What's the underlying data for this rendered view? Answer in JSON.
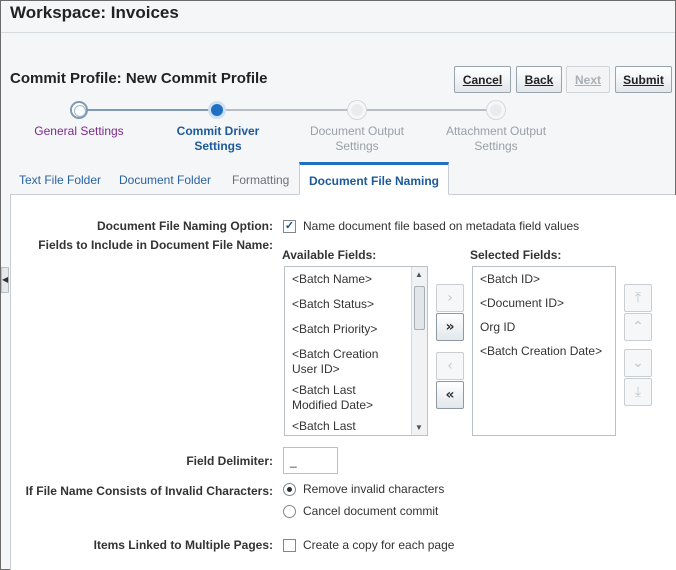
{
  "workspace_title": "Workspace: Invoices",
  "profile_title": "Commit Profile: New Commit Profile",
  "buttons": {
    "cancel": "Cancel",
    "back": "Back",
    "next": "Next",
    "submit": "Submit"
  },
  "train": {
    "steps": [
      {
        "line1": "General Settings",
        "line2": "",
        "state": "visited"
      },
      {
        "line1": "Commit Driver",
        "line2": "Settings",
        "state": "current"
      },
      {
        "line1": "Document Output",
        "line2": "Settings",
        "state": "unvisited"
      },
      {
        "line1": "Attachment Output",
        "line2": "Settings",
        "state": "unvisited"
      }
    ]
  },
  "tabs": [
    "Text File Folder",
    "Document Folder",
    "Formatting",
    "Document File Naming"
  ],
  "form": {
    "naming_option_label": "Document File Naming Option:",
    "naming_option_checked": true,
    "naming_option_text": "Name document file based on metadata field values",
    "fields_label": "Fields to Include in Document File Name:",
    "available_header": "Available Fields:",
    "selected_header": "Selected Fields:",
    "available_fields": [
      "<Batch Name>",
      "<Batch Status>",
      "<Batch Priority>",
      "<Batch Creation User ID>",
      "<Batch Last Modified Date>",
      "<Batch Last Modified User>"
    ],
    "selected_fields": [
      "<Batch ID>",
      "<Document ID>",
      "Org ID",
      "<Batch Creation Date>"
    ],
    "delimiter_label": "Field Delimiter:",
    "delimiter_value": "_",
    "invalid_label": "If File Name Consists of Invalid Characters:",
    "invalid_opt1": "Remove invalid characters",
    "invalid_opt2": "Cancel document commit",
    "invalid_selected": 1,
    "multi_label": "Items Linked to Multiple Pages:",
    "multi_checked": false,
    "multi_text": "Create a copy for each page"
  },
  "shuttle": {
    "move": "›",
    "move_all": "»",
    "remove": "‹",
    "remove_all": "«"
  },
  "reorder": {
    "top": "⤒",
    "up": "⌃",
    "down": "⌄",
    "bottom": "⤓"
  },
  "colors": {
    "accent": "#1f6fc2",
    "visited_link": "#7b2a8c",
    "tab_link": "#2a62a0"
  }
}
